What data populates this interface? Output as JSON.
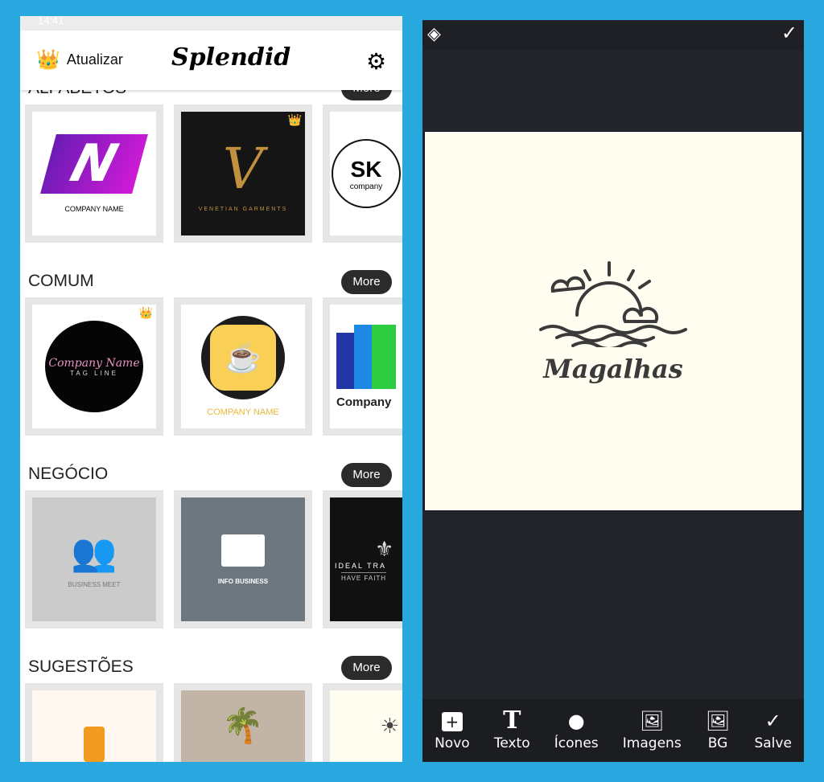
{
  "status": {
    "time": "14:41"
  },
  "header": {
    "upgrade_label": "Atualizar",
    "brand": "Splendid",
    "icons": {
      "upgrade": "crown-icon",
      "settings": "gear-icon"
    }
  },
  "sections": [
    {
      "title": "ALFABETOS",
      "more": "More",
      "cards": [
        {
          "text": "COMPANY NAME",
          "mark": "N"
        },
        {
          "text": "VENETIAN GARMENTS",
          "mark": "V",
          "premium": true
        },
        {
          "text": "company",
          "mark": "SK"
        }
      ]
    },
    {
      "title": "COMUM",
      "more": "More",
      "cards": [
        {
          "text": "Company Name",
          "sub": "TAG LINE",
          "premium": true
        },
        {
          "text": "COMPANY NAME"
        },
        {
          "text": "Company"
        }
      ]
    },
    {
      "title": "NEGÓCIO",
      "more": "More",
      "cards": [
        {
          "text": "BUSINESS MEET"
        },
        {
          "text": "INFO BUSINESS"
        },
        {
          "text": "IDEAL TRA",
          "sub": "HAVE FAITH"
        }
      ]
    },
    {
      "title": "SUGESTÕES",
      "more": "More",
      "cards": [
        {},
        {},
        {}
      ]
    }
  ],
  "editor": {
    "icons": {
      "layers": "layers-icon",
      "confirm": "check-icon"
    },
    "logo_text": "Magalhas",
    "canvas_color": "#fffdf0",
    "toolbar": [
      {
        "label": "Novo",
        "icon": "plus-square-icon"
      },
      {
        "label": "Texto",
        "icon": "text-icon"
      },
      {
        "label": "Ícones",
        "icon": "sticker-icon"
      },
      {
        "label": "Imagens",
        "icon": "image-upload-icon"
      },
      {
        "label": "BG",
        "icon": "image-icon"
      },
      {
        "label": "Salve",
        "icon": "check-icon"
      }
    ]
  }
}
